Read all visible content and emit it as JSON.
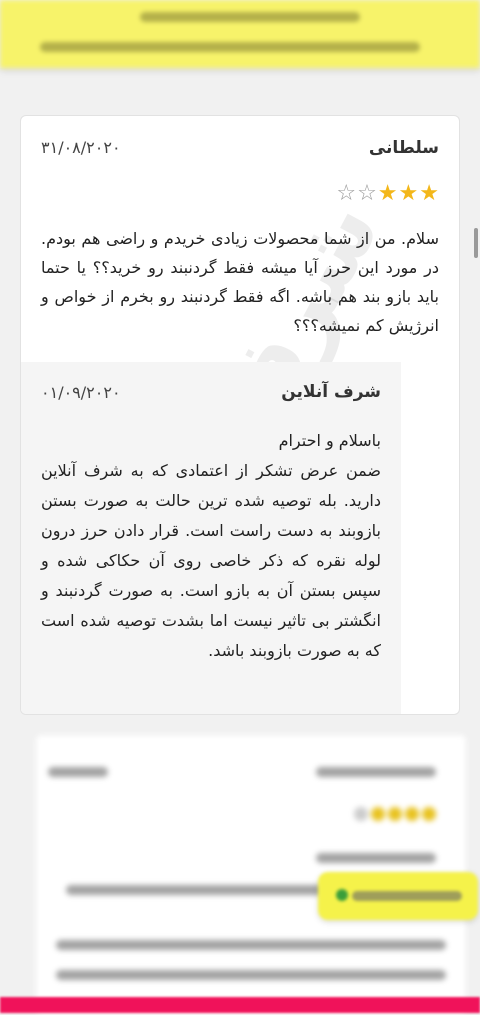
{
  "review": {
    "author": "سلطانی",
    "date": "۳۱/۰۸/۲۰۲۰",
    "rating": 3,
    "max_rating": 5,
    "text": "سلام. من از شما محصولات زیادی خریدم و راضی هم بودم. در مورد این حرز آیا میشه فقط گردنبند رو خرید؟؟ یا حتما باید بازو بند هم باشه. اگه فقط گردنبند رو بخرم از خواص و انرژیش کم نمیشه؟؟؟"
  },
  "reply": {
    "author": "شرف آنلاین",
    "date": "۰۱/۰۹/۲۰۲۰",
    "greeting": "باسلام و احترام",
    "text": "ضمن عرض تشکر از اعتمادی که به شرف آنلاین دارید. بله توصیه شده ترین حالت به صورت بستن بازوبند به دست راست است. قرار دادن حرز درون لوله نقره که ذکر خاصی روی آن حکاکی شده و سپس بستن آن به بازو است. به صورت گردنبند و انگشتر بی تاثیر نیست اما بشدت توصیه شده است که به صورت بازوبند باشد."
  },
  "watermark": "شرف آنلاین",
  "colors": {
    "star_on": "#f3b71a",
    "star_off": "#9a9a9a",
    "top_banner": "#f7f36a",
    "bottom_strip": "#f0125a"
  }
}
